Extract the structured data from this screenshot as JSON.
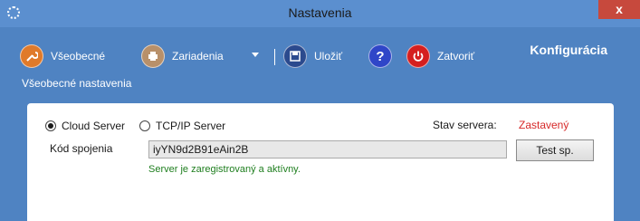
{
  "window": {
    "title": "Nastavenia",
    "close_glyph": "x"
  },
  "toolbar": {
    "general_label": "Všeobecné",
    "devices_label": "Zariadenia",
    "save_label": "Uložiť",
    "help_glyph": "?",
    "close_label": "Zatvoriť",
    "heading": "Konfigurácia",
    "subtitle": "Všeobecné nastavenia"
  },
  "connection": {
    "options": [
      {
        "label": "Cloud Server",
        "selected": true
      },
      {
        "label": "TCP/IP Server",
        "selected": false
      }
    ],
    "status_label": "Stav servera:",
    "status_value": "Zastavený",
    "code_label": "Kód spojenia",
    "code_value": "iyYN9d2B91eAin2B",
    "test_button": "Test sp.",
    "message": "Server je zaregistrovaný a aktívny."
  },
  "colors": {
    "background": "#4f83c2",
    "status_stopped": "#d62828",
    "message_ok": "#1e7e1e"
  }
}
